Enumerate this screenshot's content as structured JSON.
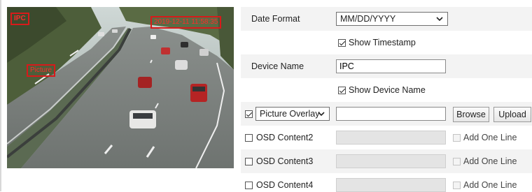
{
  "preview": {
    "osd_ipc": "IPC",
    "osd_timestamp": "2019-12-11 11:58:35",
    "osd_picture": "Picture"
  },
  "date_format": {
    "label": "Date Format",
    "value": "MM/DD/YYYY"
  },
  "show_timestamp": {
    "label": "Show Timestamp",
    "checked": true
  },
  "device_name": {
    "label": "Device Name",
    "value": "IPC"
  },
  "show_device_name": {
    "label": "Show Device Name",
    "checked": true
  },
  "picture_overlay": {
    "checked": true,
    "select_value": "Picture Overlay",
    "file_value": "",
    "browse_label": "Browse",
    "upload_label": "Upload"
  },
  "osd_rows": [
    {
      "label": "OSD Content2",
      "add_line_label": "Add One Line",
      "value": ""
    },
    {
      "label": "OSD Content3",
      "add_line_label": "Add One Line",
      "value": ""
    },
    {
      "label": "OSD Content4",
      "add_line_label": "Add One Line",
      "value": ""
    }
  ],
  "icons": {
    "dropdown": "chevron-down-icon",
    "checkbox": "checkbox-icon"
  }
}
